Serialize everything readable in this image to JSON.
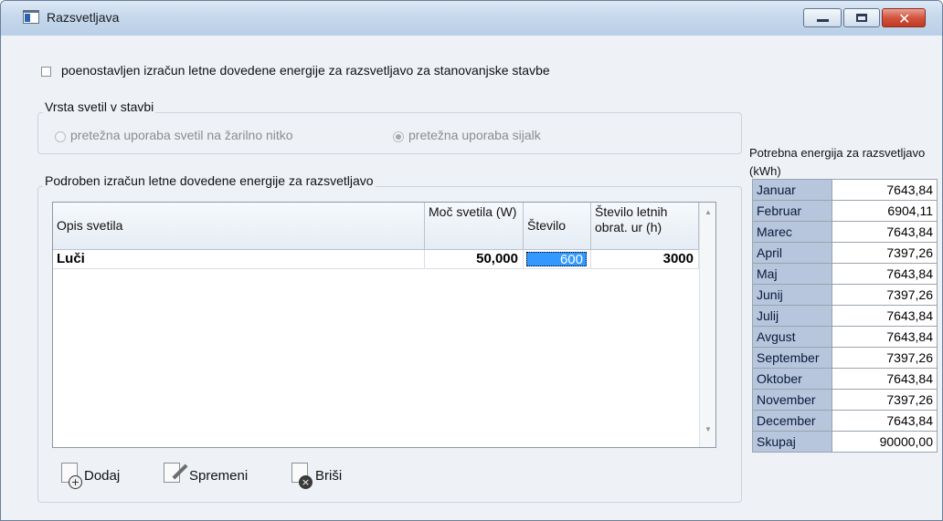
{
  "window": {
    "title": "Razsvetljava"
  },
  "options": {
    "simplified_checkbox_label": "poenostavljen izračun letne dovedene energije za razsvetljavo za stanovanjske stavbe",
    "simplified_checked": false
  },
  "lamp_type": {
    "group_title": "Vrsta svetil v stavbi",
    "options": [
      "pretežna uporaba svetil na žarilno nitko",
      "pretežna uporaba sijalk"
    ],
    "selected_index": 1
  },
  "detail": {
    "group_title": "Podroben izračun letne dovedene energije za razsvetljavo",
    "columns": [
      "Opis svetila",
      "Moč svetila (W)",
      "Število",
      "Število letnih obrat. ur (h)"
    ],
    "rows": [
      {
        "opis": "Luči",
        "moc": "50,000",
        "stevilo": "600",
        "ure": "3000"
      }
    ]
  },
  "toolbar": {
    "add_label": "Dodaj",
    "edit_label": "Spremeni",
    "delete_label": "Briši"
  },
  "energy": {
    "title": "Potrebna energija za razsvetljavo (kWh)",
    "rows": [
      {
        "month": "Januar",
        "value": "7643,84"
      },
      {
        "month": "Februar",
        "value": "6904,11"
      },
      {
        "month": "Marec",
        "value": "7643,84"
      },
      {
        "month": "April",
        "value": "7397,26"
      },
      {
        "month": "Maj",
        "value": "7643,84"
      },
      {
        "month": "Junij",
        "value": "7397,26"
      },
      {
        "month": "Julij",
        "value": "7643,84"
      },
      {
        "month": "Avgust",
        "value": "7643,84"
      },
      {
        "month": "September",
        "value": "7397,26"
      },
      {
        "month": "Oktober",
        "value": "7643,84"
      },
      {
        "month": "November",
        "value": "7397,26"
      },
      {
        "month": "December",
        "value": "7643,84"
      },
      {
        "month": "Skupaj",
        "value": "90000,00"
      }
    ]
  },
  "colors": {
    "title_bar": "#c6d8ec",
    "close_button": "#c94a33",
    "selection": "#3399ff",
    "month_cell": "#b7c6dc"
  },
  "icons": [
    "window-app-icon",
    "minimize-icon",
    "maximize-icon",
    "close-icon",
    "add-icon",
    "edit-icon",
    "delete-icon",
    "scroll-up-arrow-icon",
    "scroll-down-arrow-icon"
  ]
}
